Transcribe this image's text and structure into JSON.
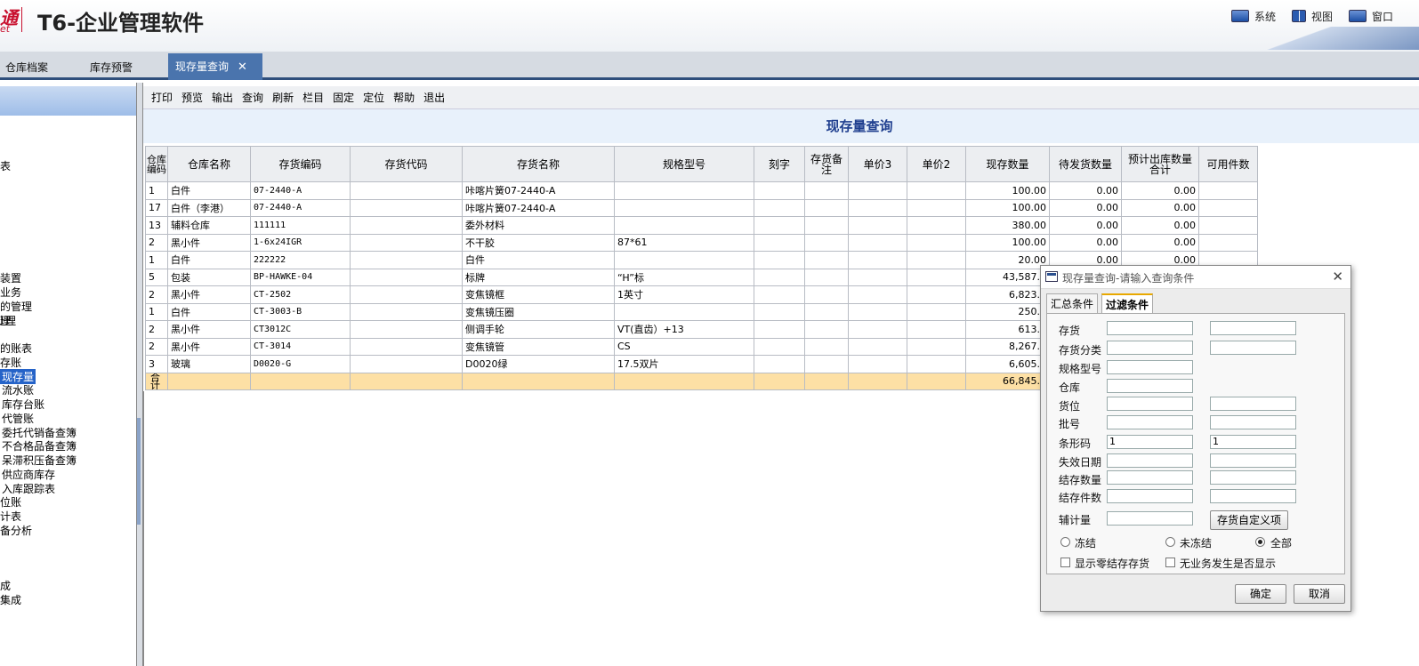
{
  "brand": {
    "logo_fragment": "通",
    "logo_fragment_sub": "et",
    "app_title": "T6-企业管理软件"
  },
  "top_menu": [
    "系统",
    "视图",
    "窗口"
  ],
  "tabs": [
    "仓库档案",
    "库存预警",
    "现存量查询"
  ],
  "tab_close": "✕",
  "nav": [
    "表",
    "装置",
    "业务",
    "理",
    "的管理",
    "处理",
    "的账表",
    "存账",
    "现存量",
    "流水账",
    "库存台账",
    "代管账",
    "委托代销备查簿",
    "不合格品备查簿",
    "呆滞积压备查簿",
    "供应商库存",
    "入库跟踪表",
    "位账",
    "计表",
    "备分析",
    "成",
    "集成"
  ],
  "toolbar": [
    "打印",
    "预览",
    "输出",
    "查询",
    "刷新",
    "栏目",
    "固定",
    "定位",
    "帮助",
    "退出"
  ],
  "report_title": "现存量查询",
  "table": {
    "headers": [
      "仓库编码",
      "仓库名称",
      "存货编码",
      "存货代码",
      "存货名称",
      "规格型号",
      "刻字",
      "存货备注",
      "单价3",
      "单价2",
      "现存数量",
      "待发货数量",
      "预计出库数量合计",
      "可用件数"
    ],
    "rows": [
      [
        "1",
        "白件",
        "07-2440-A",
        "",
        "咔喀片簧07-2440-A",
        "",
        "",
        "",
        "",
        "",
        "100.00",
        "0.00",
        "0.00",
        ""
      ],
      [
        "17",
        "白件（李港）",
        "07-2440-A",
        "",
        "咔喀片簧07-2440-A",
        "",
        "",
        "",
        "",
        "",
        "100.00",
        "0.00",
        "0.00",
        ""
      ],
      [
        "13",
        "辅料仓库",
        "111111",
        "",
        "委外材料",
        "",
        "",
        "",
        "",
        "",
        "380.00",
        "0.00",
        "0.00",
        ""
      ],
      [
        "2",
        "黑小件",
        "1-6x24IGR",
        "",
        "不干胶",
        "87*61",
        "",
        "",
        "",
        "",
        "100.00",
        "0.00",
        "0.00",
        ""
      ],
      [
        "1",
        "白件",
        "222222",
        "",
        "白件",
        "",
        "",
        "",
        "",
        "",
        "20.00",
        "0.00",
        "0.00",
        ""
      ],
      [
        "5",
        "包装",
        "BP-HAWKE-04",
        "",
        "标牌",
        "“H”标",
        "",
        "",
        "",
        "",
        "43,587.0",
        "",
        "",
        ""
      ],
      [
        "2",
        "黑小件",
        "CT-2502",
        "",
        "变焦镜框",
        "1英寸",
        "",
        "",
        "",
        "",
        "6,823.0",
        "",
        "",
        ""
      ],
      [
        "1",
        "白件",
        "CT-3003-B",
        "",
        "变焦镜压圈",
        "",
        "",
        "",
        "",
        "",
        "250.0",
        "",
        "",
        ""
      ],
      [
        "2",
        "黑小件",
        "CT3012C",
        "",
        "侧调手轮",
        "VT(直齿）+13",
        "",
        "",
        "",
        "",
        "613.0",
        "",
        "",
        ""
      ],
      [
        "2",
        "黑小件",
        "CT-3014",
        "",
        "变焦镜管",
        "CS",
        "",
        "",
        "",
        "",
        "8,267.0",
        "",
        "",
        ""
      ],
      [
        "3",
        "玻璃",
        "D0020-G",
        "",
        "D0020绿",
        "17.5双片",
        "",
        "",
        "",
        "",
        "6,605.0",
        "",
        "",
        ""
      ]
    ],
    "total_label": "合计",
    "total_qty": "66,845.0"
  },
  "dialog": {
    "title": "现存量查询-请输入查询条件",
    "close": "✕",
    "tabs": [
      "汇总条件",
      "过滤条件"
    ],
    "fields": [
      "存货",
      "存货分类",
      "规格型号",
      "仓库",
      "货位",
      "批号",
      "条形码",
      "失效日期",
      "结存数量",
      "结存件数"
    ],
    "barcode_from": "1",
    "barcode_to": "1",
    "aux_label": "辅计量",
    "custom_button": "存货自定义项",
    "radios": [
      "冻结",
      "未冻结",
      "全部"
    ],
    "radio_selected": "全部",
    "checks": [
      "显示零结存存货",
      "无业务发生是否显示"
    ],
    "ok": "确定",
    "cancel": "取消"
  }
}
